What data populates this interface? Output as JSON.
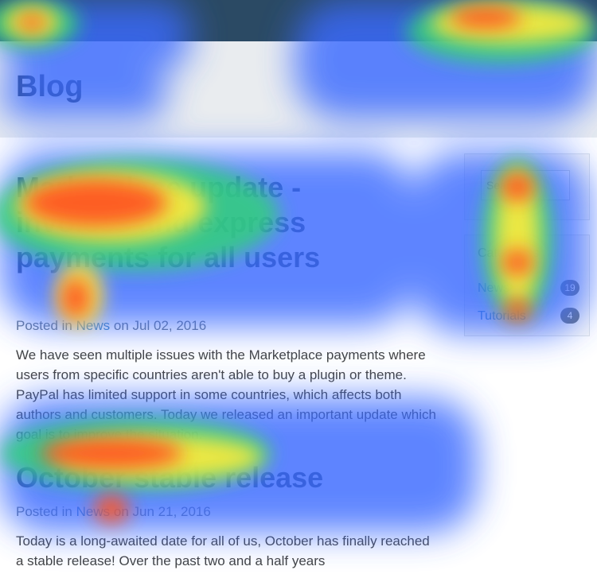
{
  "header": {
    "title": "Blog"
  },
  "posts": [
    {
      "title": "Marketplace update - invoices and express payments for all users",
      "meta_prefix": "Posted in",
      "category": "News",
      "date_prefix": "on",
      "date": "Jul 02, 2016",
      "excerpt": "We have seen multiple issues with the Marketplace payments where users from specific countries aren't able to buy a plugin or theme. PayPal has limited support in some countries, which affects both authors and customers. Today we released an important update which goal is to improve the situation."
    },
    {
      "title": "October stable release",
      "meta_prefix": "Posted in",
      "category": "News",
      "date_prefix": "on",
      "date": "Jun 21, 2016",
      "excerpt": "Today is a long-awaited date for all of us, October has finally reached a stable release! Over the past two and a half years"
    }
  ],
  "sidebar": {
    "search_placeholder": "Search",
    "categories_title": "Categories",
    "categories": [
      {
        "label": "News",
        "count": "19"
      },
      {
        "label": "Tutorials",
        "count": "4"
      }
    ]
  },
  "colors": {
    "topbar": "#2b4a64",
    "header_bg": "#e9ecef",
    "title": "#2c3e50",
    "link": "#3b83c4"
  }
}
